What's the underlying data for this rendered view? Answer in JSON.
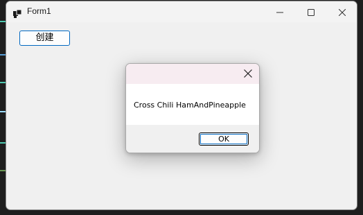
{
  "window": {
    "title": "Form1",
    "icon": "app-icon",
    "controls": [
      "minimize-icon",
      "maximize-icon",
      "close-icon"
    ]
  },
  "form": {
    "create_button_label": "创建"
  },
  "message_box": {
    "message": "Cross Chili HamAndPineapple",
    "ok_label": "OK",
    "close_icon": "close-icon"
  },
  "colors": {
    "accent": "#0067c0",
    "window_bg": "#f0f0f0",
    "dialog_title_bg": "#f7ecf1",
    "editor_bg": "#1e1e1e"
  }
}
